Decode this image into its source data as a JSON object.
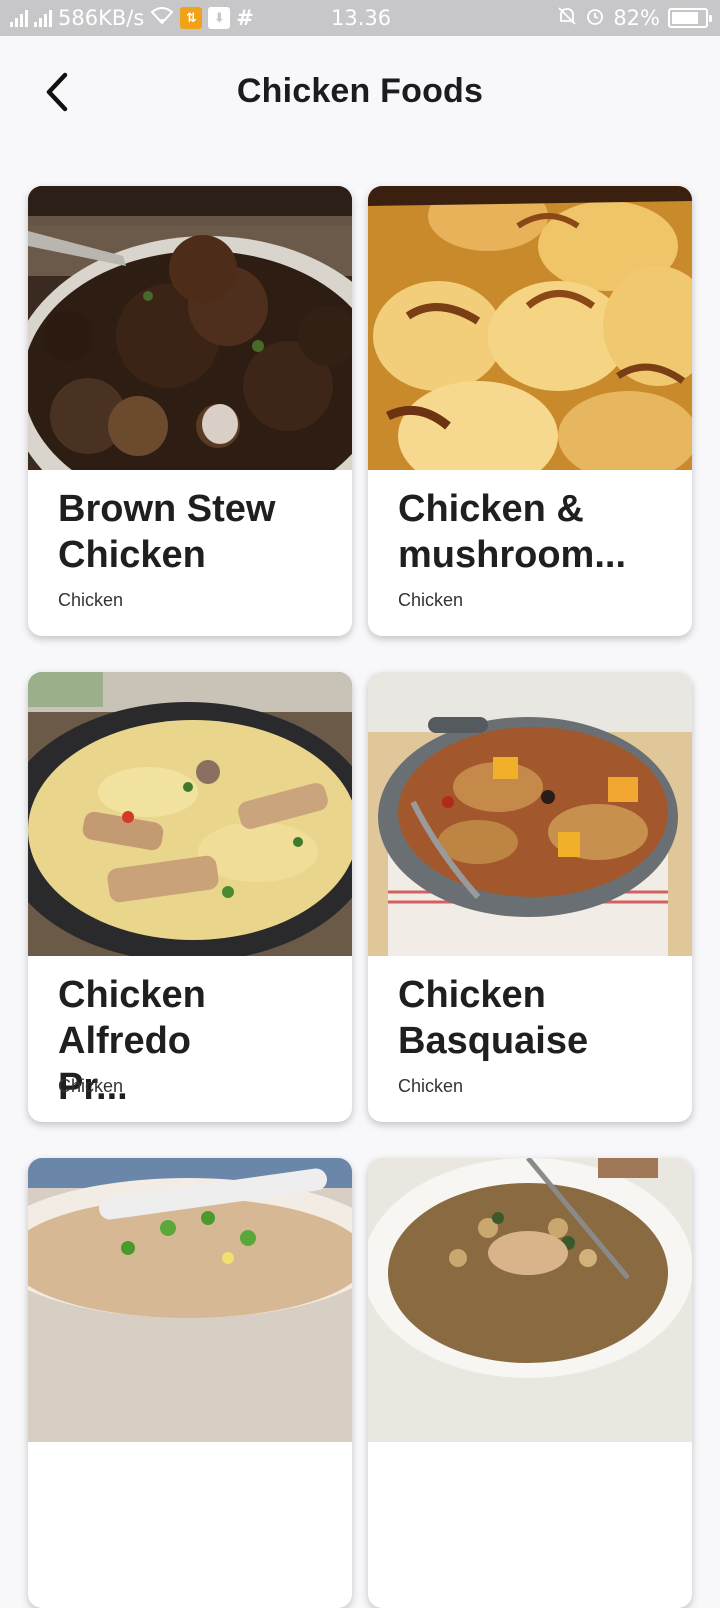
{
  "status_bar": {
    "network_speed": "586KB/s",
    "time": "13.36",
    "battery_percent": "82%",
    "battery_level": 0.82,
    "icons": [
      "signal-icon",
      "signal-icon",
      "wifi-icon",
      "sim-icon",
      "download-icon",
      "hash-icon",
      "mute-icon",
      "alarm-icon",
      "battery-icon"
    ]
  },
  "header": {
    "back_icon": "chevron-left-icon",
    "title": "Chicken Foods"
  },
  "meals": [
    {
      "name": "Brown Stew\nChicken",
      "category": "Chicken",
      "image": "brown-stew-chicken-photo"
    },
    {
      "name": "Chicken &\nmushroom...",
      "category": "Chicken",
      "image": "chicken-mushroom-photo"
    },
    {
      "name": "Chicken Alfredo\nPr...",
      "category": "Chicken",
      "image": "chicken-alfredo-photo"
    },
    {
      "name": "Chicken\nBasquaise",
      "category": "Chicken",
      "image": "chicken-basquaise-photo"
    },
    {
      "name": "",
      "category": "",
      "image": "congee-photo"
    },
    {
      "name": "",
      "category": "",
      "image": "chicken-barley-photo"
    }
  ],
  "colors": {
    "background": "#f8f8fb",
    "status_bar": "#c7c7c9",
    "card": "#ffffff",
    "title_text": "#1f1f1f"
  }
}
